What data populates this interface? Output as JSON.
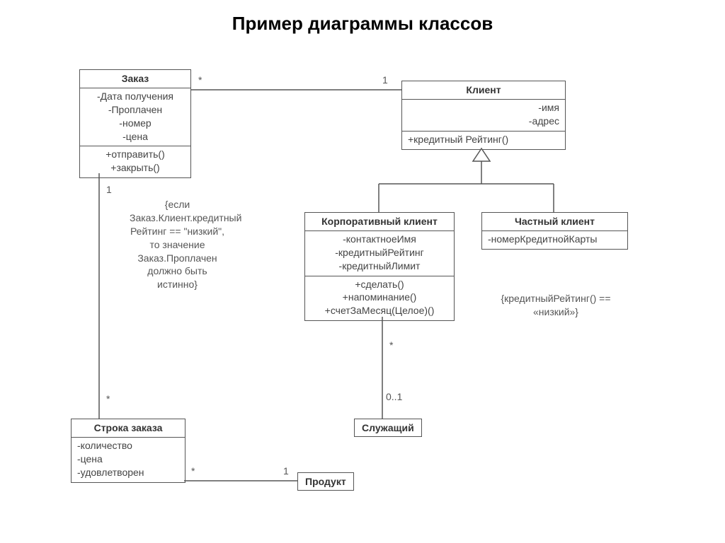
{
  "title": "Пример диаграммы классов",
  "classes": {
    "order": {
      "name": "Заказ",
      "attrs": [
        "-Дата получения",
        "-Проплачен",
        "-номер",
        "-цена"
      ],
      "ops": [
        "+отправить()",
        "+закрыть()"
      ]
    },
    "client": {
      "name": "Клиент",
      "attrs": [
        "-имя",
        "-адрес"
      ],
      "ops": [
        "+кредитный Рейтинг()"
      ]
    },
    "corpClient": {
      "name": "Корпоративный клиент",
      "attrs": [
        "-контактноеИмя",
        "-кредитныйРейтинг",
        "-кредитныйЛимит"
      ],
      "ops": [
        "+сделать()",
        "+напоминание()",
        "+счетЗаМесяц(Целое)()"
      ]
    },
    "privClient": {
      "name": "Частный клиент",
      "attrs": [
        "-номерКредитнойКарты"
      ]
    },
    "orderLine": {
      "name": "Строка заказа",
      "attrs": [
        "-количество",
        "-цена",
        "-удовлетворен"
      ]
    },
    "employee": {
      "name": "Служащий"
    },
    "product": {
      "name": "Продукт"
    }
  },
  "constraints": {
    "orderPaid": "{если Заказ.Клиент.кредитный Рейтинг == \"низкий\", то значение Заказ.Проплачен должно быть истинно}",
    "privRating": "{кредитныйРейтинг() == «низкий»}"
  },
  "multiplicities": {
    "order_client_left": "*",
    "order_client_right": "1",
    "order_line_top": "1",
    "order_line_bottom": "*",
    "corp_emp_top": "*",
    "corp_emp_bottom": "0..1",
    "line_product_left": "*",
    "line_product_right": "1"
  }
}
